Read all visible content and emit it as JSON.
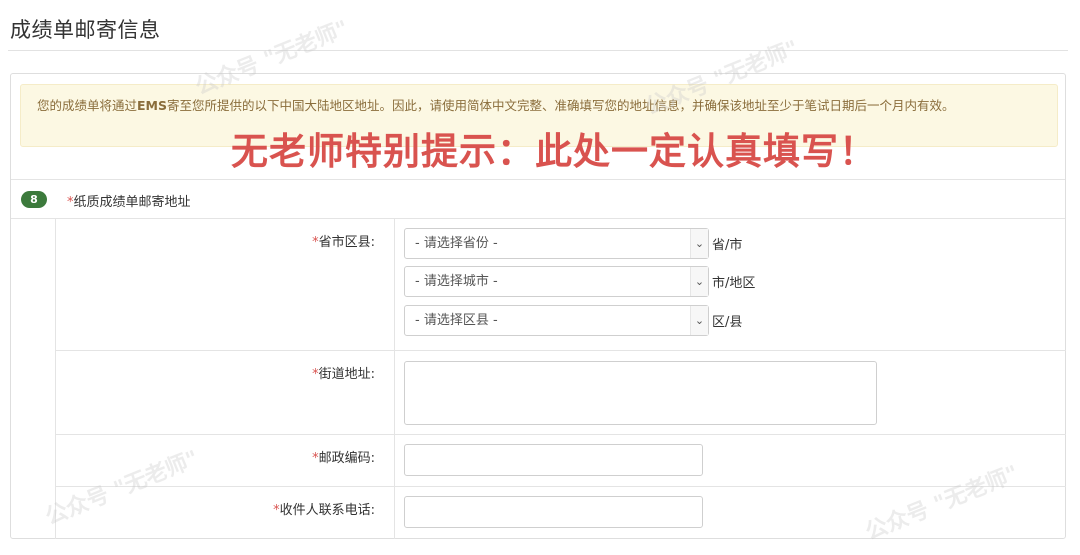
{
  "page": {
    "title": "成绩单邮寄信息"
  },
  "notice": {
    "text_before": "您的成绩单将通过",
    "text_bold": "EMS",
    "text_after": "寄至您所提供的以下中国大陆地区地址。因此，请使用简体中文完整、准确填写您的地址信息，并确保该地址至少于笔试日期后一个月内有效。"
  },
  "emphasis": {
    "text": "无老师特别提示：此处一定认真填写！"
  },
  "section": {
    "step": "8",
    "required_mark": "*",
    "label": "纸质成绩单邮寄地址"
  },
  "form": {
    "region": {
      "required_mark": "*",
      "label": "省市区县:",
      "province_placeholder": "- 请选择省份 -",
      "province_unit": "省/市",
      "city_placeholder": "- 请选择城市 -",
      "city_unit": "市/地区",
      "district_placeholder": "- 请选择区县 -",
      "district_unit": "区/县"
    },
    "street": {
      "required_mark": "*",
      "label": "街道地址:",
      "value": ""
    },
    "postal": {
      "required_mark": "*",
      "label": "邮政编码:",
      "value": ""
    },
    "phone": {
      "required_mark": "*",
      "label": "收件人联系电话:",
      "value": ""
    }
  },
  "watermark": {
    "text": "公众号 \"无老师\""
  },
  "icons": {
    "select_arrow": "chevron-down-icon"
  }
}
